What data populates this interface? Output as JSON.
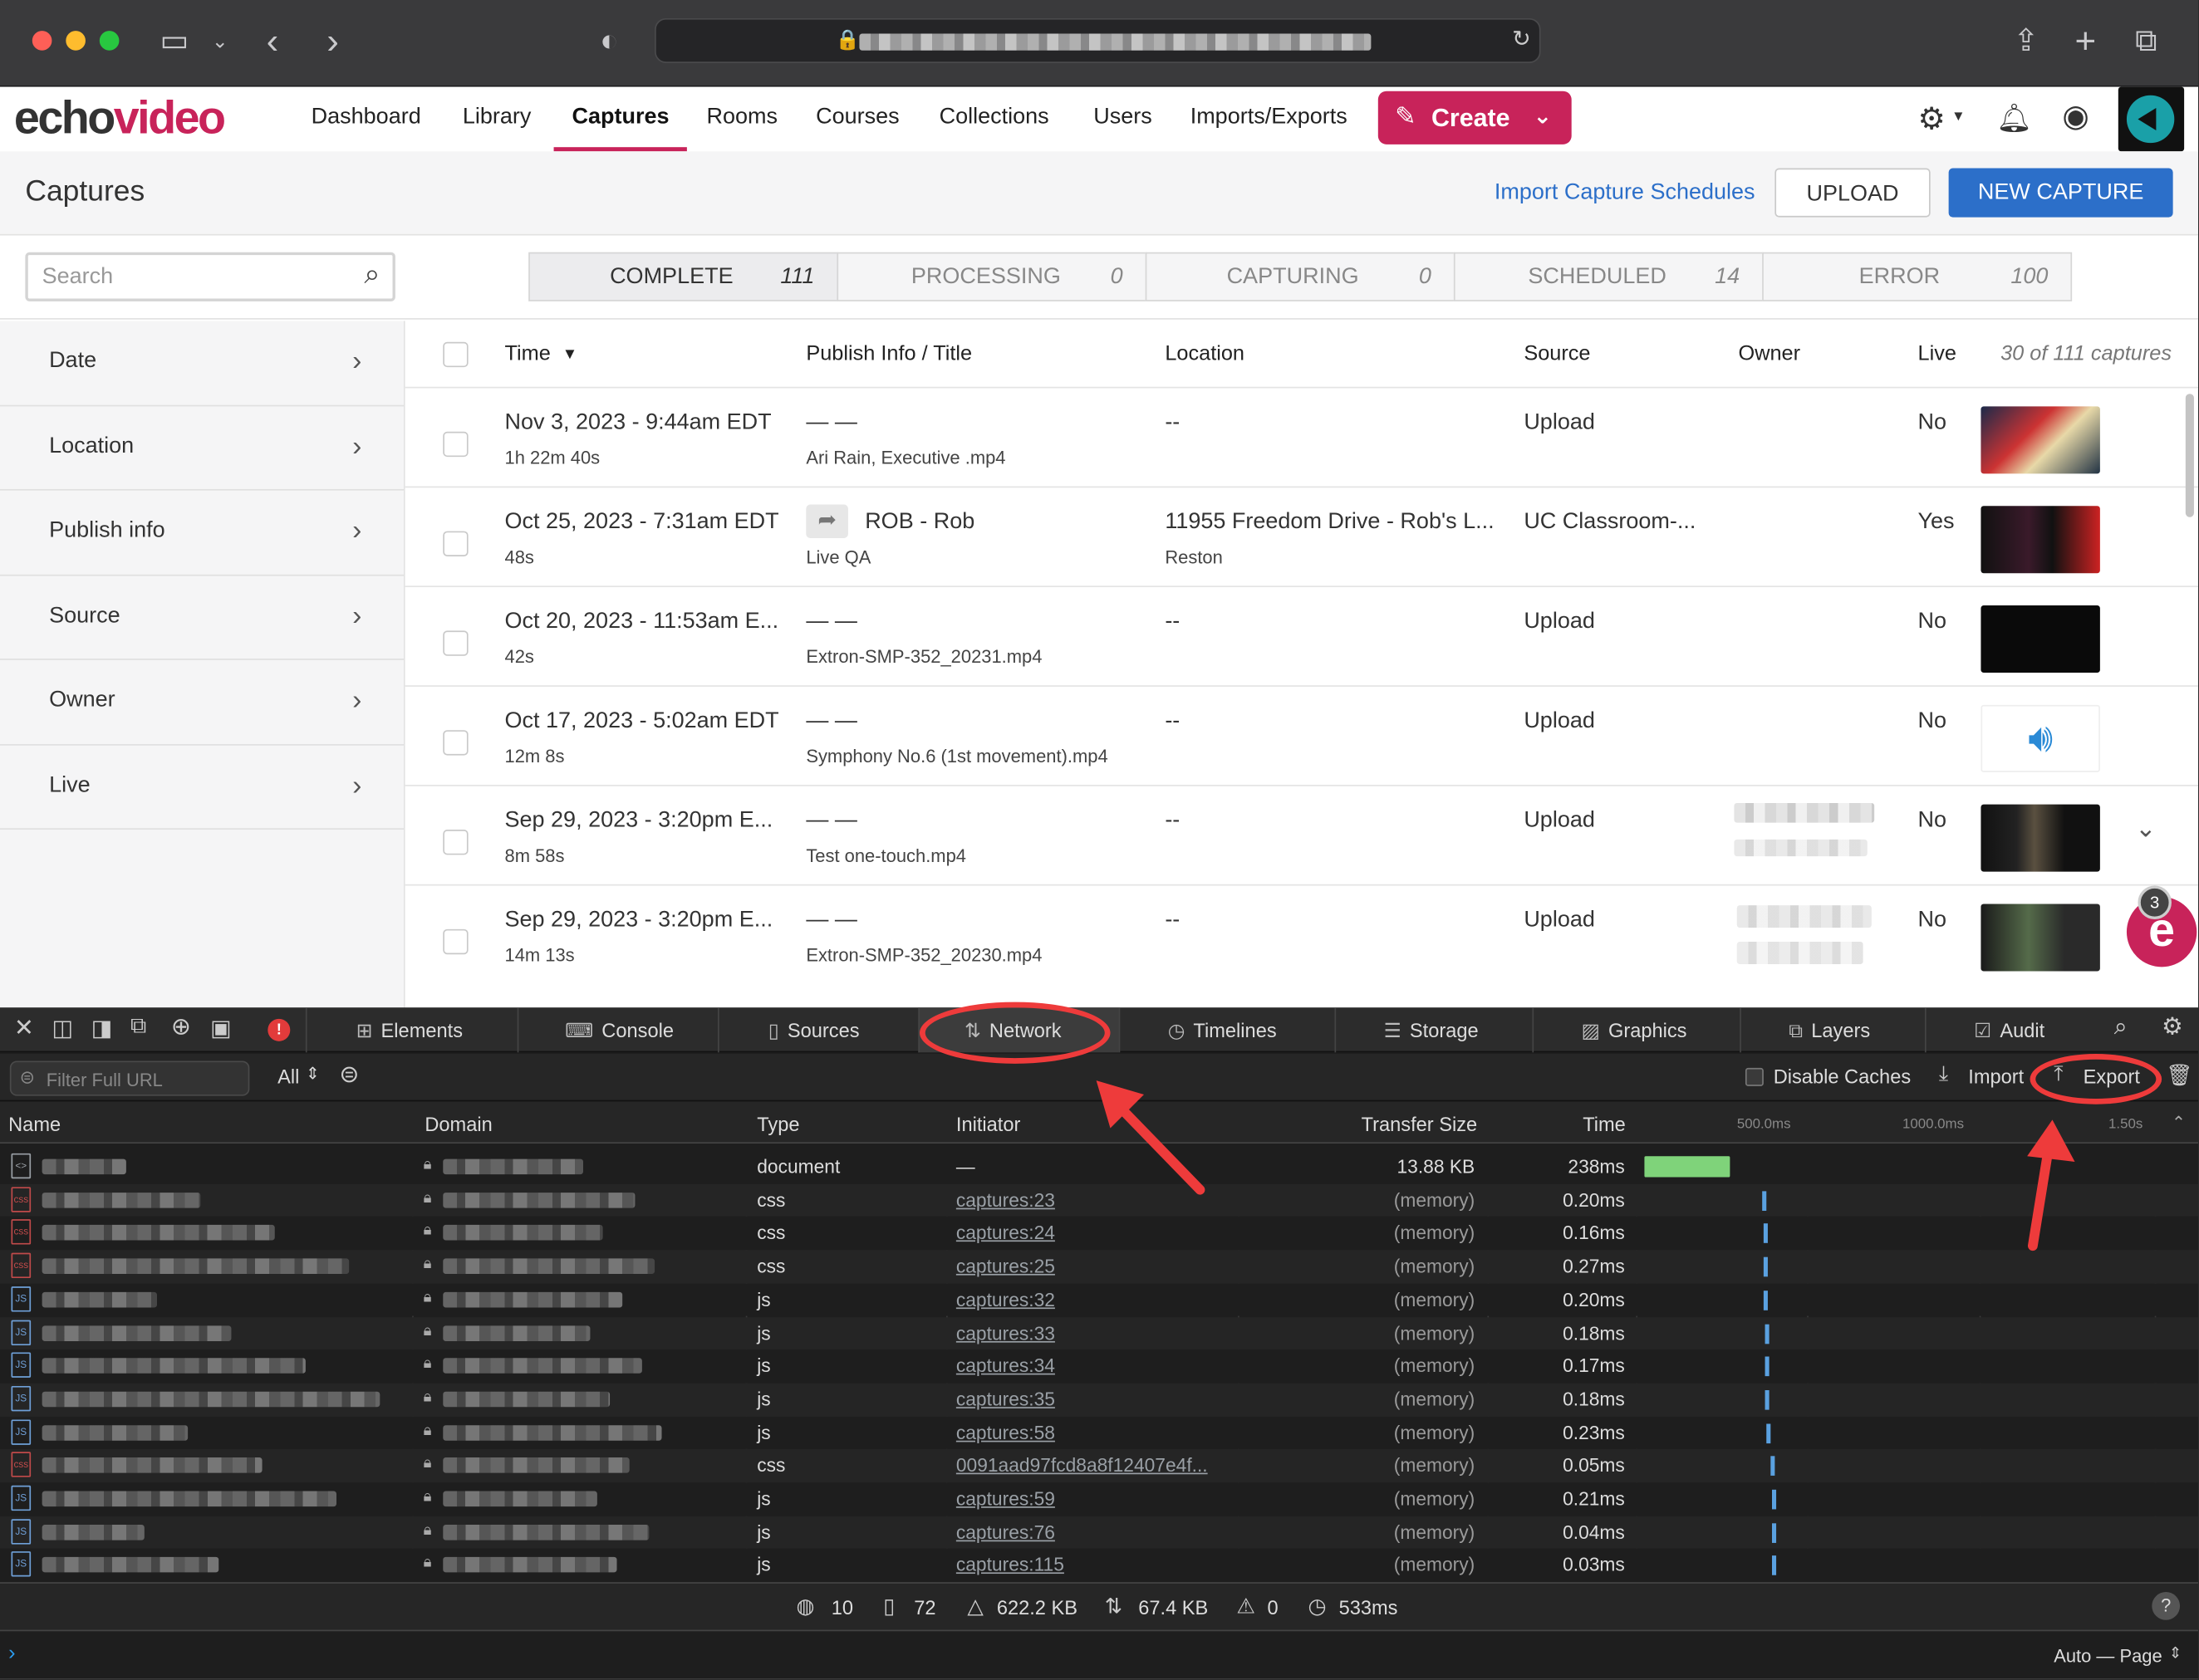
{
  "browser": {
    "tab_title": "",
    "url_text": ""
  },
  "brand": {
    "logo_echo": "echo",
    "logo_video": "video",
    "accent": "#c8235a",
    "blue": "#2c6fc9"
  },
  "nav": {
    "items": [
      "Dashboard",
      "Library",
      "Captures",
      "Rooms",
      "Courses",
      "Collections",
      "Users",
      "Imports/Exports"
    ],
    "active": "Captures",
    "create_label": "Create"
  },
  "page": {
    "title": "Captures",
    "import_link": "Import Capture Schedules",
    "upload_label": "UPLOAD",
    "new_capture_label": "NEW CAPTURE"
  },
  "search": {
    "placeholder": "Search"
  },
  "status_tabs": [
    {
      "label": "COMPLETE",
      "count": "111"
    },
    {
      "label": "PROCESSING",
      "count": "0"
    },
    {
      "label": "CAPTURING",
      "count": "0"
    },
    {
      "label": "SCHEDULED",
      "count": "14"
    },
    {
      "label": "ERROR",
      "count": "100"
    }
  ],
  "filters": [
    "Date",
    "Location",
    "Publish info",
    "Source",
    "Owner",
    "Live"
  ],
  "table": {
    "headers": {
      "time": "Time",
      "publish": "Publish Info / Title",
      "location": "Location",
      "source": "Source",
      "owner": "Owner",
      "live": "Live",
      "count": "30 of 111 captures"
    },
    "rows": [
      {
        "time": "Nov 3, 2023 - 9:44am EDT",
        "duration": "1h 22m 40s",
        "publish": "— —",
        "title": "Ari Rain, Executive .mp4",
        "location": "--",
        "location_sub": "",
        "source": "Upload",
        "live": "No"
      },
      {
        "time": "Oct 25, 2023 - 7:31am EDT",
        "duration": "48s",
        "publish": "ROB - Rob",
        "title": "Live QA",
        "location": "11955 Freedom Drive - Rob's L...",
        "location_sub": "Reston",
        "source": "UC Classroom-...",
        "live": "Yes"
      },
      {
        "time": "Oct 20, 2023 - 11:53am E...",
        "duration": "42s",
        "publish": "— —",
        "title": "Extron-SMP-352_20231.mp4",
        "location": "--",
        "location_sub": "",
        "source": "Upload",
        "live": "No"
      },
      {
        "time": "Oct 17, 2023 - 5:02am EDT",
        "duration": "12m 8s",
        "publish": "— —",
        "title": "Symphony No.6 (1st movement).mp4",
        "location": "--",
        "location_sub": "",
        "source": "Upload",
        "live": "No"
      },
      {
        "time": "Sep 29, 2023 - 3:20pm E...",
        "duration": "8m 58s",
        "publish": "— —",
        "title": "Test one-touch.mp4",
        "location": "--",
        "location_sub": "",
        "source": "Upload",
        "live": "No"
      },
      {
        "time": "Sep 29, 2023 - 3:20pm E...",
        "duration": "14m 13s",
        "publish": "— —",
        "title": "Extron-SMP-352_20230.mp4",
        "location": "--",
        "location_sub": "",
        "source": "Upload",
        "live": "No"
      }
    ]
  },
  "chat_badge": "3",
  "devtools": {
    "tabs": [
      "Elements",
      "Console",
      "Sources",
      "Network",
      "Timelines",
      "Storage",
      "Graphics",
      "Layers",
      "Audit"
    ],
    "active_tab": "Network",
    "filter_placeholder": "Filter Full URL",
    "type_filter": "All",
    "disable_caches": "Disable Caches",
    "import_label": "Import",
    "export_label": "Export",
    "columns": {
      "name": "Name",
      "domain": "Domain",
      "type": "Type",
      "initiator": "Initiator",
      "transfer": "Transfer Size",
      "time": "Time"
    },
    "timeline_ticks": [
      "500.0ms",
      "1000.0ms",
      "1.50s"
    ],
    "requests": [
      {
        "icon": "<>",
        "type": "document",
        "initiator": "—",
        "size": "13.88 KB",
        "time": "238ms"
      },
      {
        "icon": "css",
        "type": "css",
        "initiator": "captures:23",
        "size": "(memory)",
        "time": "0.20ms"
      },
      {
        "icon": "css",
        "type": "css",
        "initiator": "captures:24",
        "size": "(memory)",
        "time": "0.16ms"
      },
      {
        "icon": "css",
        "type": "css",
        "initiator": "captures:25",
        "size": "(memory)",
        "time": "0.27ms"
      },
      {
        "icon": "JS",
        "type": "js",
        "initiator": "captures:32",
        "size": "(memory)",
        "time": "0.20ms"
      },
      {
        "icon": "JS",
        "type": "js",
        "initiator": "captures:33",
        "size": "(memory)",
        "time": "0.18ms"
      },
      {
        "icon": "JS",
        "type": "js",
        "initiator": "captures:34",
        "size": "(memory)",
        "time": "0.17ms"
      },
      {
        "icon": "JS",
        "type": "js",
        "initiator": "captures:35",
        "size": "(memory)",
        "time": "0.18ms"
      },
      {
        "icon": "JS",
        "type": "js",
        "initiator": "captures:58",
        "size": "(memory)",
        "time": "0.23ms"
      },
      {
        "icon": "css",
        "type": "css",
        "initiator": "0091aad97fcd8a8f12407e4f...",
        "size": "(memory)",
        "time": "0.05ms"
      },
      {
        "icon": "JS",
        "type": "js",
        "initiator": "captures:59",
        "size": "(memory)",
        "time": "0.21ms"
      },
      {
        "icon": "JS",
        "type": "js",
        "initiator": "captures:76",
        "size": "(memory)",
        "time": "0.04ms"
      },
      {
        "icon": "JS",
        "type": "js",
        "initiator": "captures:115",
        "size": "(memory)",
        "time": "0.03ms"
      }
    ],
    "status": {
      "requests": "10",
      "resources": "72",
      "transferred": "622.2 KB",
      "size": "67.4 KB",
      "errors": "0",
      "time": "533ms"
    },
    "bottom_right": "Auto — Page"
  }
}
